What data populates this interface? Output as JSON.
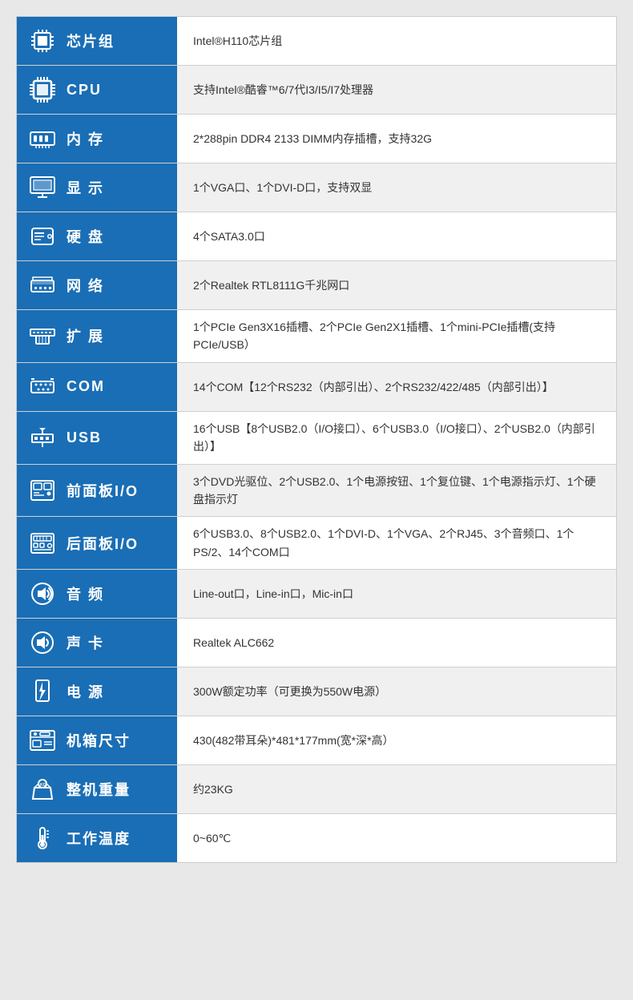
{
  "rows": [
    {
      "id": "chipset",
      "label": "芯片组",
      "value": "Intel®H110芯片组",
      "icon": "chipset"
    },
    {
      "id": "cpu",
      "label": "CPU",
      "value": "支持Intel®酷睿™6/7代I3/I5/I7处理器",
      "icon": "cpu"
    },
    {
      "id": "memory",
      "label": "内 存",
      "value": "2*288pin DDR4 2133 DIMM内存插槽，支持32G",
      "icon": "memory"
    },
    {
      "id": "display",
      "label": "显 示",
      "value": "1个VGA口、1个DVI-D口，支持双显",
      "icon": "display"
    },
    {
      "id": "storage",
      "label": "硬 盘",
      "value": "4个SATA3.0口",
      "icon": "storage"
    },
    {
      "id": "network",
      "label": "网 络",
      "value": "2个Realtek RTL8111G千兆网口",
      "icon": "network"
    },
    {
      "id": "expansion",
      "label": "扩 展",
      "value": "1个PCIe Gen3X16插槽、2个PCIe Gen2X1插槽、1个mini-PCIe插槽(支持PCIe/USB）",
      "icon": "expansion"
    },
    {
      "id": "com",
      "label": "COM",
      "value": "14个COM【12个RS232（内部引出）、2个RS232/422/485（内部引出）】",
      "icon": "com"
    },
    {
      "id": "usb",
      "label": "USB",
      "value": "16个USB【8个USB2.0（I/O接口）、6个USB3.0（I/O接口）、2个USB2.0（内部引出）】",
      "icon": "usb"
    },
    {
      "id": "front-panel",
      "label": "前面板I/O",
      "value": "3个DVD光驱位、2个USB2.0、1个电源按钮、1个复位键、1个电源指示灯、1个硬盘指示灯",
      "icon": "front-panel"
    },
    {
      "id": "rear-panel",
      "label": "后面板I/O",
      "value": "6个USB3.0、8个USB2.0、1个DVI-D、1个VGA、2个RJ45、3个音频口、1个PS/2、14个COM口",
      "icon": "rear-panel"
    },
    {
      "id": "audio",
      "label": "音 频",
      "value": "Line-out口，Line-in口，Mic-in口",
      "icon": "audio"
    },
    {
      "id": "sound-card",
      "label": "声 卡",
      "value": "Realtek ALC662",
      "icon": "sound-card"
    },
    {
      "id": "power",
      "label": "电 源",
      "value": "300W额定功率（可更换为550W电源）",
      "icon": "power"
    },
    {
      "id": "chassis",
      "label": "机箱尺寸",
      "value": "430(482带耳朵)*481*177mm(宽*深*高）",
      "icon": "chassis"
    },
    {
      "id": "weight",
      "label": "整机重量",
      "value": "约23KG",
      "icon": "weight"
    },
    {
      "id": "temperature",
      "label": "工作温度",
      "value": "0~60℃",
      "icon": "temperature"
    }
  ]
}
